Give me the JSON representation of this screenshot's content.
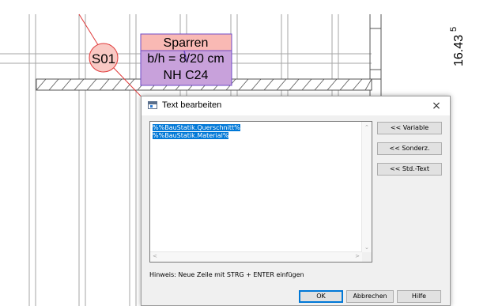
{
  "drawing": {
    "beam_marker": "S01",
    "label_lines": [
      "Sparren",
      "b/h = 8/20 cm",
      "NH C24"
    ],
    "dimension_value": "16.43",
    "dimension_superscript": "5"
  },
  "dialog": {
    "title": "Text bearbeiten",
    "close_glyph": "×",
    "editor_lines": [
      "%%BauStatik.Querschnitt%",
      "%%BauStatik.Material%"
    ],
    "buttons": {
      "variable": "<< Variable",
      "sonderz": "<< Sonderz.",
      "std_text": "<< Std.-Text",
      "ok": "OK",
      "abbrechen": "Abbrechen",
      "hilfe": "Hilfe"
    },
    "hint": "Hinweis: Neue Zeile mit STRG + ENTER einfügen"
  },
  "colors": {
    "label_top": "#f9b9b4",
    "label_bottom": "#c8a1db",
    "label_border": "#6f4bc7",
    "marker_fill": "#f9c9c4",
    "marker_stroke": "#e03a3a",
    "selection": "#0078d7"
  }
}
